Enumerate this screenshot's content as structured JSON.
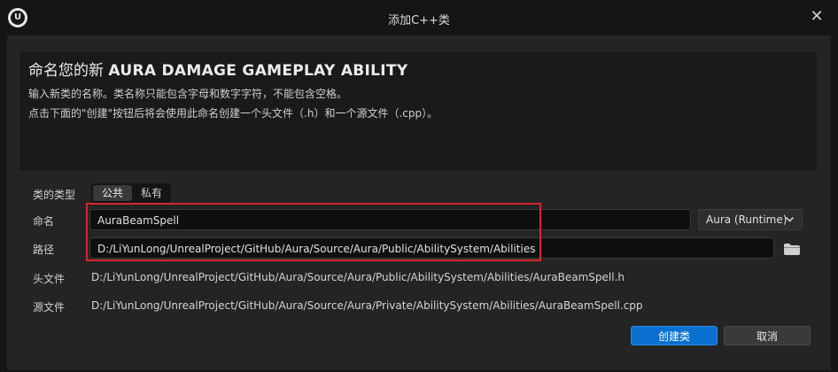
{
  "window": {
    "title": "添加C++类",
    "logo_letter": "U",
    "close_glyph": "✕"
  },
  "header": {
    "heading_prefix": "命名您的新",
    "heading_class": "AURA DAMAGE GAMEPLAY ABILITY",
    "desc_line1": "输入新类的名称。类名称只能包含字母和数字字符，不能包含空格。",
    "desc_line2": "点击下面的\"创建\"按钮后将会使用此命名创建一个头文件（.h）和一个源文件（.cpp）。"
  },
  "form": {
    "class_type_label": "类的类型",
    "class_type_options": [
      "公共",
      "私有"
    ],
    "class_type_selected": "公共",
    "name_label": "命名",
    "name_value": "AuraBeamSpell",
    "module_value": "Aura (Runtime)",
    "path_label": "路径",
    "path_value": "D:/LiYunLong/UnrealProject/GitHub/Aura/Source/Aura/Public/AbilitySystem/Abilities",
    "header_label": "头文件",
    "header_value": "D:/LiYunLong/UnrealProject/GitHub/Aura/Source/Aura/Public/AbilitySystem/Abilities/AuraBeamSpell.h",
    "source_label": "源文件",
    "source_value": "D:/LiYunLong/UnrealProject/GitHub/Aura/Source/Aura/Private/AbilitySystem/Abilities/AuraBeamSpell.cpp"
  },
  "buttons": {
    "create_label": "创建类",
    "cancel_label": "取消"
  },
  "icons": {
    "close": "close-icon",
    "folder": "folder-icon",
    "dropdown": "chevron-down-icon",
    "logo": "unreal-logo-icon"
  },
  "colors": {
    "accent": "#0a70d0",
    "highlight_annotation": "#d6262e",
    "background": "#151515",
    "panel": "#242424"
  }
}
